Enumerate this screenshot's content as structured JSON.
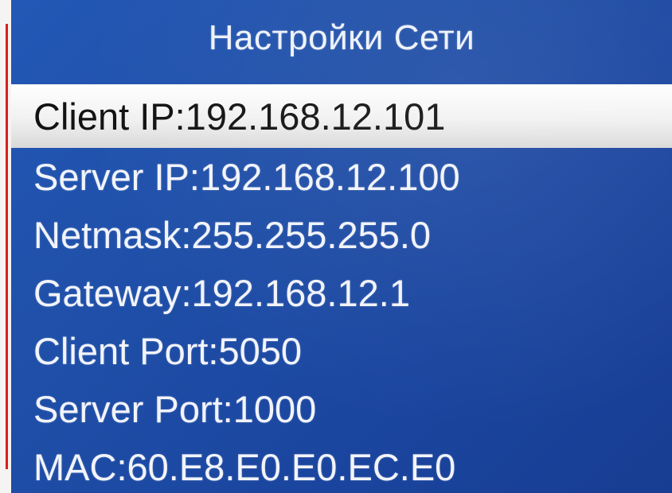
{
  "screen": {
    "title": "Настройки Сети"
  },
  "menu": {
    "items": [
      {
        "label": "Client IP:192.168.12.101",
        "selected": true
      },
      {
        "label": "Server IP:192.168.12.100",
        "selected": false
      },
      {
        "label": "Netmask:255.255.255.0",
        "selected": false
      },
      {
        "label": "Gateway:192.168.12.1",
        "selected": false
      },
      {
        "label": "Client Port:5050",
        "selected": false
      },
      {
        "label": "Server Port:1000",
        "selected": false
      },
      {
        "label": "MAC:60.E8.E0.E0.EC.E0",
        "selected": false
      }
    ]
  },
  "colors": {
    "screen_background": "#1f4fa8",
    "text": "#f2f4fa",
    "selection_background": "#f1f1f1",
    "selection_text": "#121212"
  }
}
